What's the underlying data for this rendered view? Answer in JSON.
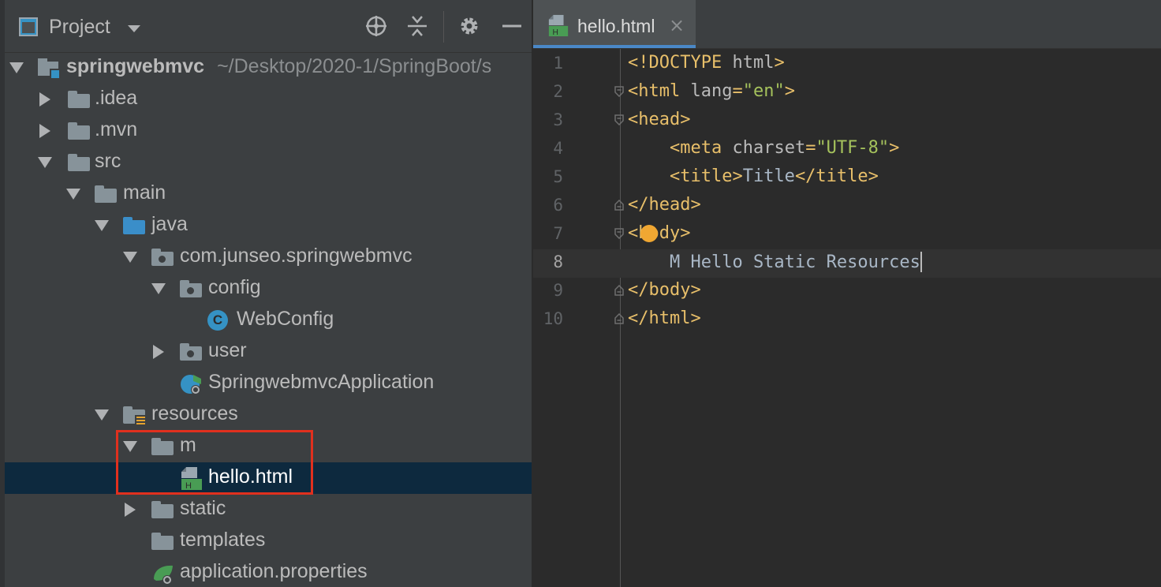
{
  "project_panel": {
    "title": "Project"
  },
  "tree": {
    "root": {
      "name": "springwebmvc",
      "path": "~/Desktop/2020-1/SpringBoot/s"
    },
    "items": [
      {
        "label": ".idea"
      },
      {
        "label": ".mvn"
      },
      {
        "label": "src"
      },
      {
        "label": "main"
      },
      {
        "label": "java"
      },
      {
        "label": "com.junseo.springwebmvc"
      },
      {
        "label": "config"
      },
      {
        "label": "WebConfig",
        "icon_letter": "C"
      },
      {
        "label": "user"
      },
      {
        "label": "SpringwebmvcApplication"
      },
      {
        "label": "resources"
      },
      {
        "label": "m"
      },
      {
        "label": "hello.html",
        "icon_letter": "H"
      },
      {
        "label": "static"
      },
      {
        "label": "templates"
      },
      {
        "label": "application.properties"
      }
    ]
  },
  "editor": {
    "tab": {
      "label": "hello.html",
      "close": "×",
      "icon_letter": "H"
    },
    "line_numbers": [
      "1",
      "2",
      "3",
      "4",
      "5",
      "6",
      "7",
      "8",
      "9",
      "10"
    ],
    "lines": [
      {
        "parts": [
          [
            "tag",
            "<!DOCTYPE "
          ],
          [
            "attr",
            "html"
          ],
          [
            "tag",
            ">"
          ]
        ]
      },
      {
        "parts": [
          [
            "tag",
            "<html "
          ],
          [
            "attr",
            "lang"
          ],
          [
            "tag",
            "="
          ],
          [
            "str",
            "\"en\""
          ],
          [
            "tag",
            ">"
          ]
        ]
      },
      {
        "parts": [
          [
            "tag",
            "<head>"
          ]
        ]
      },
      {
        "parts": [
          [
            "plain",
            "    "
          ],
          [
            "tag",
            "<meta "
          ],
          [
            "attr",
            "charset"
          ],
          [
            "tag",
            "="
          ],
          [
            "str",
            "\"UTF-8\""
          ],
          [
            "tag",
            ">"
          ]
        ]
      },
      {
        "parts": [
          [
            "plain",
            "    "
          ],
          [
            "tag",
            "<title>"
          ],
          [
            "plain",
            "Title"
          ],
          [
            "tag",
            "</title>"
          ]
        ]
      },
      {
        "parts": [
          [
            "tag",
            "</head>"
          ]
        ]
      },
      {
        "parts": [
          [
            "tag",
            "<body>"
          ]
        ]
      },
      {
        "parts": [
          [
            "plain",
            "    M Hello Static Resources"
          ]
        ]
      },
      {
        "parts": [
          [
            "tag",
            "</body>"
          ]
        ]
      },
      {
        "parts": [
          [
            "tag",
            "</html>"
          ]
        ]
      }
    ]
  },
  "colors": {
    "panel_bg": "#3c3f41",
    "editor_bg": "#2b2b2b",
    "selection_bg": "#0d293e",
    "highlight_border": "#e0301e",
    "tag": "#e8bf6a",
    "string": "#a5c25c",
    "tab_underline": "#4a88c7"
  }
}
